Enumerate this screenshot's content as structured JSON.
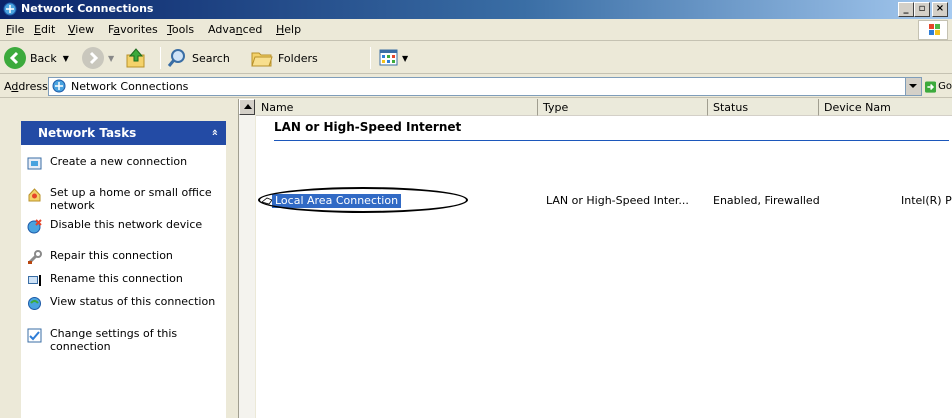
{
  "window": {
    "title": "Network Connections"
  },
  "menu": {
    "items": [
      {
        "pre": "",
        "u": "F",
        "post": "ile"
      },
      {
        "pre": "",
        "u": "E",
        "post": "dit"
      },
      {
        "pre": "",
        "u": "V",
        "post": "iew"
      },
      {
        "pre": "F",
        "u": "a",
        "post": "vorites"
      },
      {
        "pre": "",
        "u": "T",
        "post": "ools"
      },
      {
        "pre": "Adva",
        "u": "n",
        "post": "ced"
      },
      {
        "pre": "",
        "u": "H",
        "post": "elp"
      }
    ]
  },
  "toolbar": {
    "back_label": "Back",
    "search_label": "Search",
    "folders_label": "Folders"
  },
  "address": {
    "label_pre": "A",
    "label_u": "d",
    "label_post": "dress",
    "value": "Network Connections",
    "go_label": "Go"
  },
  "tasks": {
    "title": "Network Tasks",
    "collapse_glyph": "»",
    "items": [
      {
        "label": "Create a new connection",
        "icon": "create-connection-icon"
      },
      {
        "label": "Set up a home or small office network",
        "icon": "home-network-icon"
      },
      {
        "label": "Disable this network device",
        "icon": "disable-device-icon"
      },
      {
        "label": "Repair this connection",
        "icon": "repair-icon"
      },
      {
        "label": "Rename this connection",
        "icon": "rename-icon"
      },
      {
        "label": "View status of this connection",
        "icon": "status-icon"
      },
      {
        "label": "Change settings of this connection",
        "icon": "settings-icon"
      }
    ]
  },
  "list": {
    "columns": [
      "Name",
      "Type",
      "Status",
      "Device Nam"
    ],
    "group": "LAN or High-Speed Internet",
    "rows": [
      {
        "name": "Local Area Connection",
        "type": "LAN or High-Speed Inter...",
        "status": "Enabled, Firewalled",
        "device": "Intel(R) PRO"
      }
    ]
  },
  "colors": {
    "task_header": "#234ba5",
    "selection": "#316ac5",
    "group_rule": "#1c57bb"
  }
}
